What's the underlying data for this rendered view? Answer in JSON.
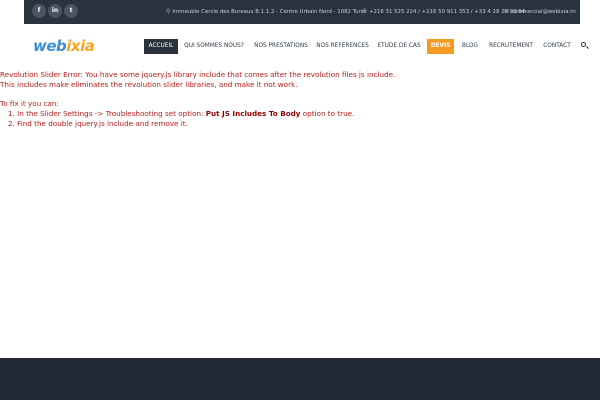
{
  "topbar": {
    "social": [
      {
        "icon": "facebook-icon",
        "glyph": "f"
      },
      {
        "icon": "linkedin-icon",
        "glyph": "in"
      },
      {
        "icon": "twitter-icon",
        "glyph": "t"
      }
    ],
    "address": "Immeuble Cercle des Bureaux B.1.1.2 - Centre Urbain Nord - 1082 Tunis",
    "phones": "+216 31 525 224 / +216 50 911 353 / +33 4 28 29 90 94",
    "email": "commercial@webixia.tn"
  },
  "logo": {
    "part1": "web",
    "part2": "ixia"
  },
  "nav": {
    "items": [
      "ACCUEIL",
      "QUI SOMMES NOUS?",
      "NOS PRESTATIONS",
      "NOS REFERENCES",
      "ETUDE DE CAS",
      "DEVIS",
      "BLOG",
      "RECRUTEMENT",
      "CONTACT"
    ],
    "active": "ACCUEIL"
  },
  "error": {
    "line1": "Revolution Slider Error: You have some jquery.js library include that comes after the revolution files js include.",
    "line2": "This includes make eliminates the revolution slider libraries, and make it not work.",
    "line3": "To fix it you can:",
    "line4_prefix": "1. In the Slider Settings -> Troubleshooting set option:",
    "line4_bold": "Put JS Includes To Body",
    "line4_suffix": "option to true.",
    "line5": "2. Find the double jquery.js include and remove it."
  },
  "colors": {
    "dark": "#2a323e",
    "accent_orange": "#f59a23",
    "error_red": "#b71c1c",
    "logo_blue": "#3a8fd6"
  }
}
